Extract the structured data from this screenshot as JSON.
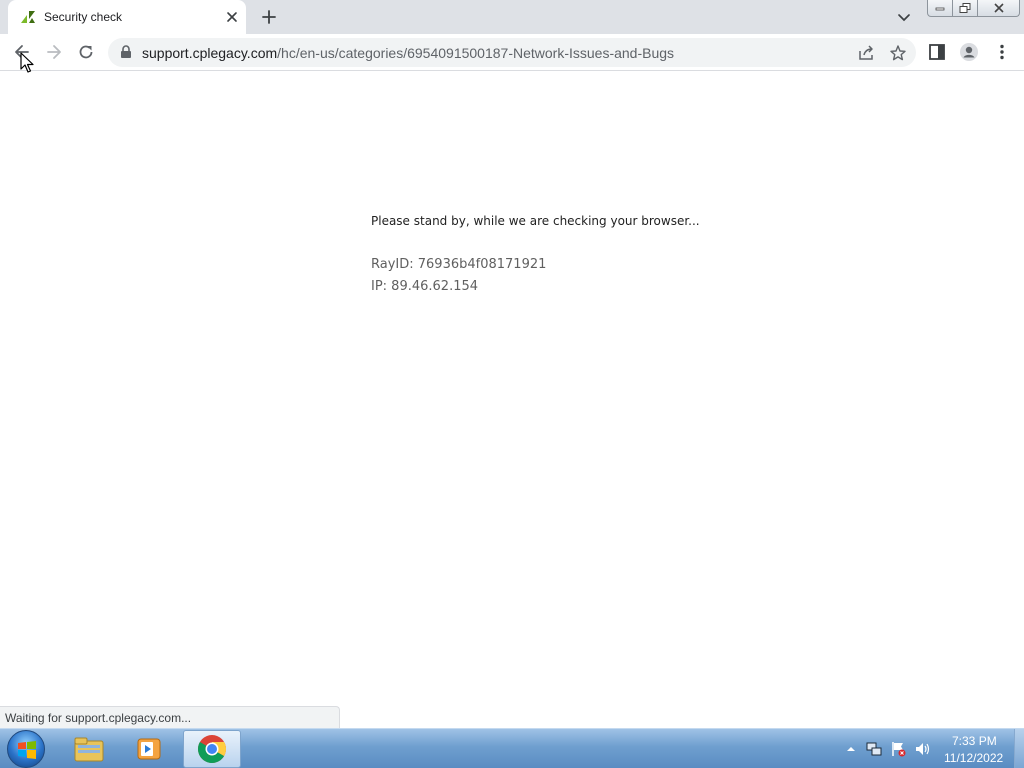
{
  "browser": {
    "tab": {
      "title": "Security check"
    },
    "omnibox": {
      "url_host": "support.cplegacy.com",
      "url_path": "/hc/en-us/categories/6954091500187-Network-Issues-and-Bugs"
    },
    "status_text": "Waiting for support.cplegacy.com..."
  },
  "page": {
    "message": "Please stand by, while we are checking your browser...",
    "ray_id": "RayID: 76936b4f08171921",
    "ip": "IP: 89.46.62.154"
  },
  "taskbar": {
    "clock_time": "7:33 PM",
    "clock_date": "11/12/2022",
    "apps": [
      "windows-explorer",
      "media-player",
      "chrome"
    ],
    "active_app": "chrome"
  },
  "colors": {
    "tab_strip": "#dee1e6",
    "omnibox": "#f1f3f4",
    "taskbar": "#6f9fcf"
  }
}
